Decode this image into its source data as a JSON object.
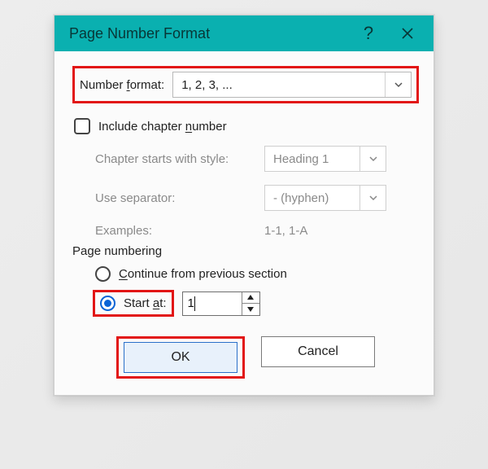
{
  "titlebar": {
    "title": "Page Number Format",
    "help_tooltip": "?",
    "close_tooltip": "Close"
  },
  "number_format": {
    "label_pre": "Number ",
    "label_u": "f",
    "label_post": "ormat:",
    "value": "1, 2, 3, ..."
  },
  "include_chapter": {
    "label_pre": "Include chapter ",
    "label_u": "n",
    "label_post": "umber",
    "checked": false
  },
  "chapter": {
    "starts_label": "Chapter starts with style:",
    "starts_value": "Heading 1",
    "sep_label": "Use separator:",
    "sep_value": "-   (hyphen)",
    "examples_label": "Examples:",
    "examples_value": "1-1, 1-A"
  },
  "page_numbering": {
    "section_label": "Page numbering",
    "continue_pre": "",
    "continue_u": "C",
    "continue_post": "ontinue from previous section",
    "start_pre": "Start ",
    "start_u": "a",
    "start_post": "t:",
    "start_value": "1",
    "selected": "start"
  },
  "buttons": {
    "ok": "OK",
    "cancel": "Cancel"
  }
}
